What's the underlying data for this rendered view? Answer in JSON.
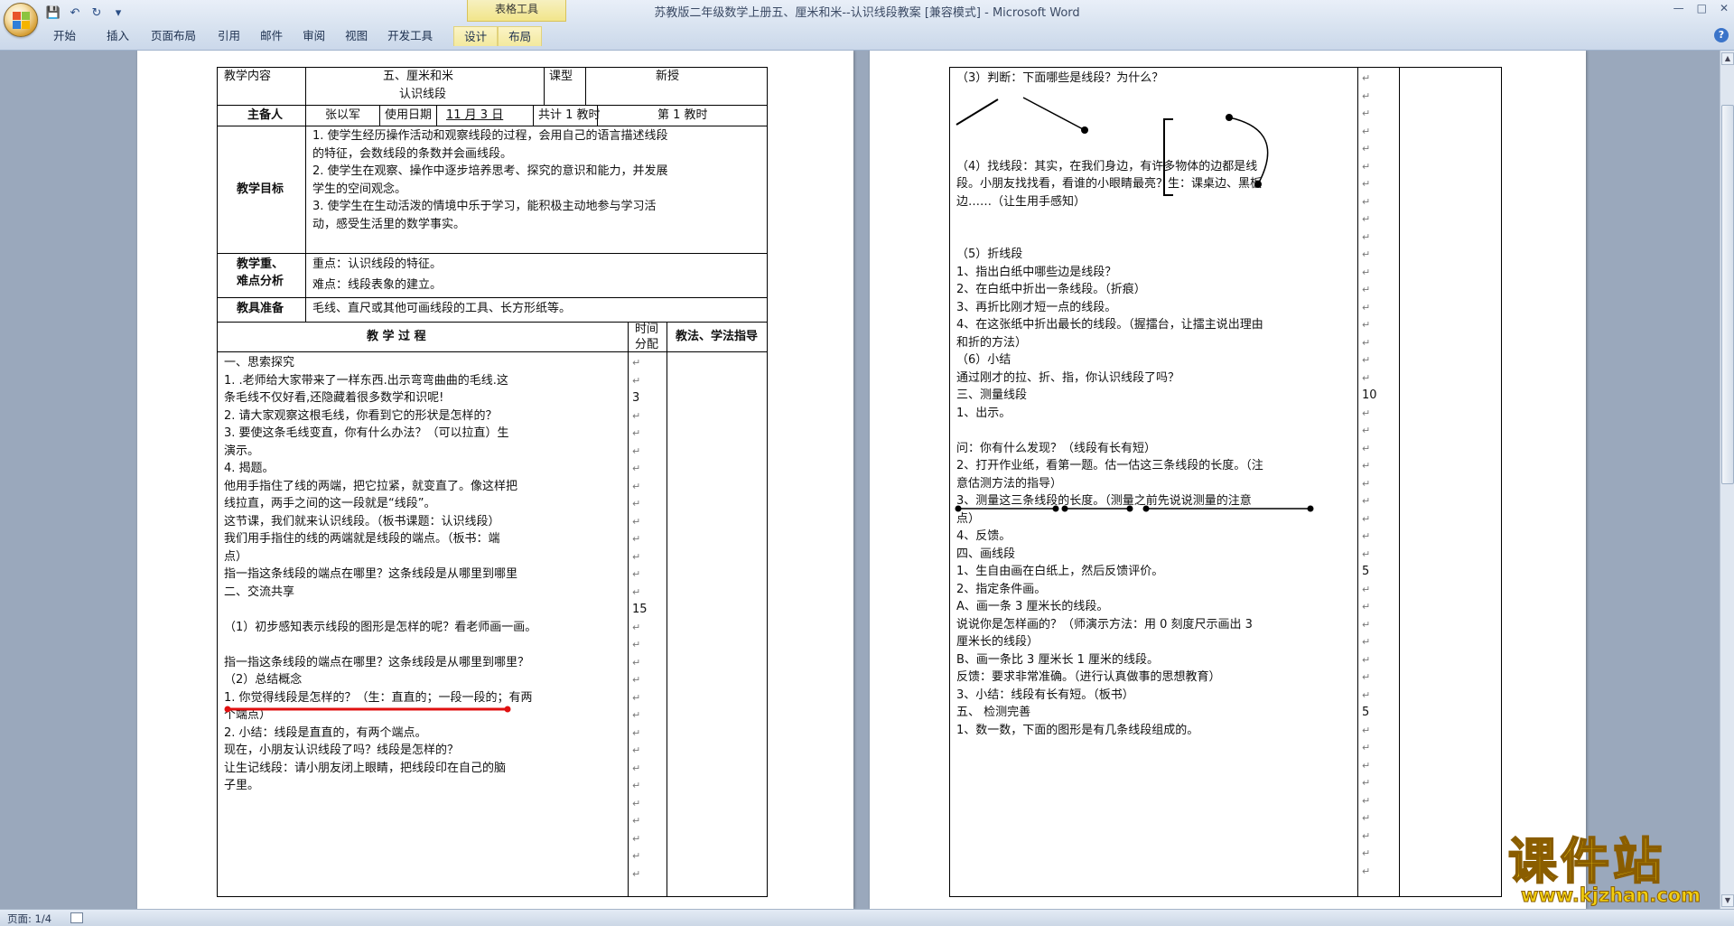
{
  "window": {
    "title": "苏教版二年级数学上册五、厘米和米--认识线段教案 [兼容模式] - Microsoft Word",
    "contextual_tools": "表格工具",
    "controls": [
      "—",
      "□",
      "✕"
    ]
  },
  "ribbon": {
    "tabs": [
      "开始",
      "插入",
      "页面布局",
      "引用",
      "邮件",
      "审阅",
      "视图",
      "开发工具",
      "设计",
      "布局"
    ]
  },
  "page1": {
    "hdr_content_label": "教学内容",
    "hdr_title1": "五、厘米和米",
    "hdr_title2": "认识线段",
    "hdr_type_label": "课型",
    "hdr_type_value": "新授",
    "prep_label": "主备人",
    "prep_name": "张以军",
    "date_label": "使用日期",
    "date_value": "11 月 3 日",
    "total_label": "共计  1   教时",
    "nth_label": "第      1      教时",
    "goals_label": "教学目标",
    "goals": [
      "1. 使学生经历操作活动和观察线段的过程，会用自己的语言描述线段",
      "的特征，会数线段的条数并会画线段。",
      "2. 使学生在观察、操作中逐步培养思考、探究的意识和能力，并发展",
      "学生的空间观念。",
      "3. 使学生在生动活泼的情境中乐于学习，能积极主动地参与学习活",
      "动，感受生活里的数学事实。"
    ],
    "keypoint_label1": "教学重、",
    "keypoint_label2": "难点分析",
    "keypoint1": "重点：认识线段的特征。",
    "keypoint2": "难点：线段表象的建立。",
    "tools_label": "教具准备",
    "tools_value": "毛线、直尺或其他可画线段的工具、长方形纸等。",
    "process_label": "教    学    过    程",
    "time_label1": "时间",
    "time_label2": "分配",
    "method_label": "教法、学法指导",
    "body": [
      "一、思索探究",
      "      1. .老师给大家带来了一样东西.出示弯弯曲曲的毛线.这",
      "条毛线不仅好看,还隐藏着很多数学和识呢!",
      "    2. 请大家观察这根毛线，你看到它的形状是怎样的？",
      "    3. 要使这条毛线变直，你有什么办法？（可以拉直）生",
      "演示。",
      "    4. 揭题。",
      "    他用手指住了线的两端，把它拉紧，就变直了。像这样把",
      "线拉直，两手之间的这一段就是“线段”。",
      " 这节课，我们就来认识线段。（板书课题：认识线段）",
      "     我们用手指住的线的两端就是线段的端点。（板书：端",
      "点）",
      "    指一指这条线段的端点在哪里？这条线段是从哪里到哪里",
      "二、交流共享",
      "",
      "（1）初步感知表示线段的图形是怎样的呢？看老师画一画。",
      "",
      "指一指这条线段的端点在哪里？这条线段是从哪里到哪里？",
      "（2）总结概念",
      "1. 你觉得线段是怎样的？（生：直直的；一段一段的；有两",
      "个端点）",
      "2. 小结：线段是直直的，有两个端点。",
      "现在，小朋友认识线段了吗？线段是怎样的？",
      "      让生记线段：请小朋友闭上眼睛，把线段印在自己的脑",
      "子里。"
    ],
    "time_marks": [
      {
        "row": 2,
        "text": "3"
      },
      {
        "row": 14,
        "text": "15"
      }
    ]
  },
  "page2": {
    "body": [
      "（3）判断：下面哪些是线段？为什么？",
      "",
      "",
      "",
      "",
      "（4）找线段：其实，在我们身边，有许多物体的边都是线",
      "段。小朋友找找看，看谁的小眼睛最亮？生：课桌边、黑板",
      "边……（让生用手感知）",
      "",
      "",
      "（5）折线段",
      "1、指出白纸中哪些边是线段？",
      "2、在白纸中折出一条线段。（折痕）",
      "3、再折比刚才短一点的线段。",
      "4、在这张纸中折出最长的线段。（握擂台，让擂主说出理由",
      "和折的方法）",
      "  （6）小结",
      "   通过刚才的拉、折、指，你认识线段了吗？",
      "三、测量线段",
      "1、出示。",
      "",
      "问：你有什么发现？（线段有长有短）",
      "2、打开作业纸，看第一题。估一估这三条线段的长度。（注",
      "意估测方法的指导）",
      "3、测量这三条线段的长度。（测量之前先说说测量的注意",
      "点）",
      "    4、反馈。",
      "四、画线段",
      "1、生自由画在白纸上，然后反馈评价。",
      "2、指定条件画。",
      "A、画一条 3 厘米长的线段。",
      "      说说你是怎样画的？（师演示方法：用 0 刻度尺示画出 3",
      "厘米长的线段）",
      "B、画一条比 3 厘米长 1 厘米的线段。",
      "      反馈：要求非常准确。（进行认真做事的思想教育）",
      "3、小结：线段有长有短。（板书）",
      "五、  检测完善",
      "1、数一数，下面的图形是有几条线段组成的。"
    ],
    "time_marks": [
      {
        "row": 18,
        "text": "10"
      },
      {
        "row": 28,
        "text": "5"
      },
      {
        "row": 36,
        "text": "5"
      }
    ]
  },
  "status": {
    "page_info": "页面: 1/4"
  },
  "watermark": {
    "main": "课件站",
    "url": "www.kjzhan.com"
  }
}
